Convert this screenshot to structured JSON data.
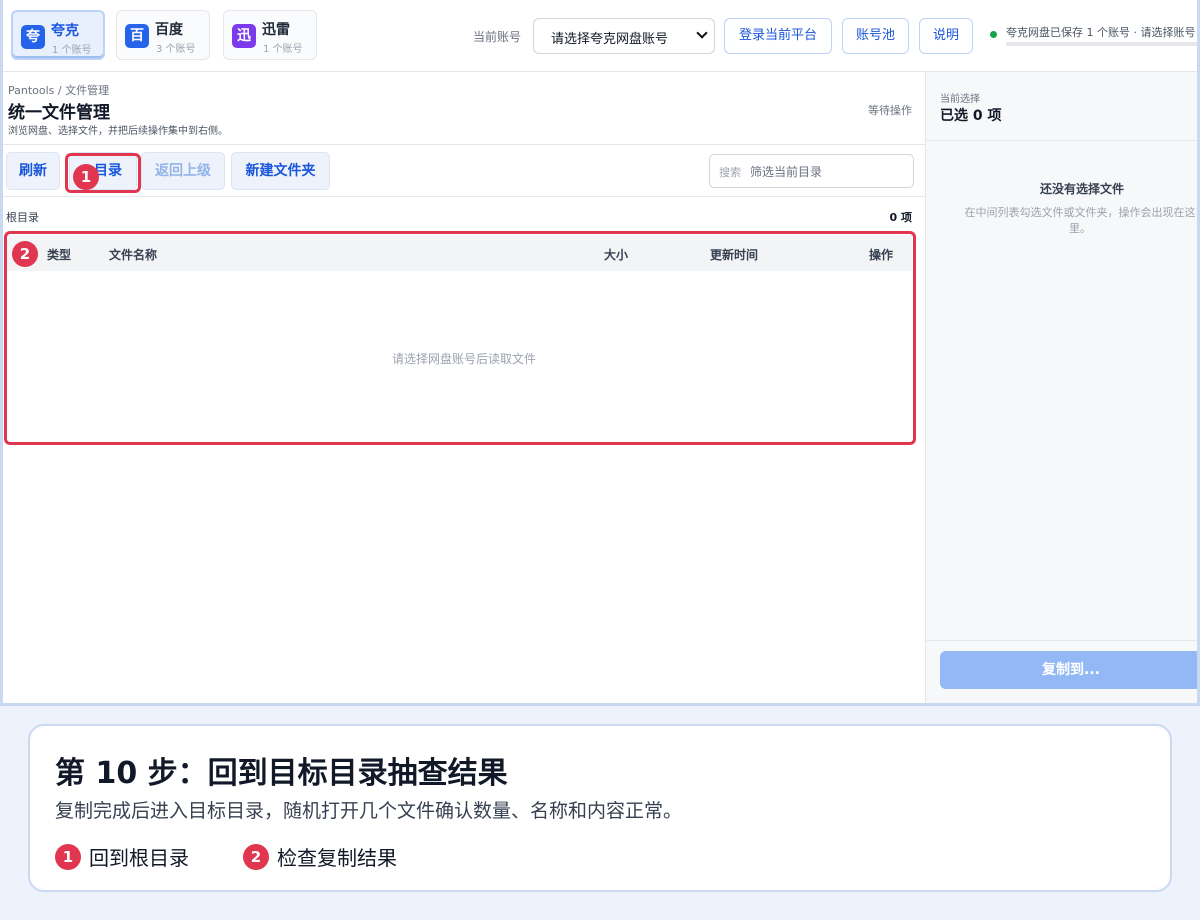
{
  "platforms": [
    {
      "name": "夸克",
      "count": "1 个账号",
      "logo": "夸",
      "color": "#2563eb"
    },
    {
      "name": "百度",
      "count": "3 个账号",
      "logo": "百",
      "color": "#2563eb"
    },
    {
      "name": "迅雷",
      "count": "1 个账号",
      "logo": "迅",
      "color": "#7c3aed"
    }
  ],
  "header": {
    "account_label": "当前账号",
    "account_select": "请选择夸克网盘账号",
    "login_btn": "登录当前平台",
    "pool_btn": "账号池",
    "help_btn": "说明",
    "status": "夸克网盘已保存 1 个账号 · 请选择账号"
  },
  "main": {
    "breadcrumb": "Pantools / 文件管理",
    "title": "统一文件管理",
    "subtitle": "浏览网盘、选择文件，并把后续操作集中到右侧。",
    "waiting": "等待操作",
    "toolbar": {
      "refresh": "刷新",
      "root": "目录",
      "up": "返回上级",
      "new_folder": "新建文件夹"
    },
    "search": {
      "label": "搜索",
      "placeholder": "筛选当前目录"
    },
    "path": "根目录",
    "count": "0 项",
    "columns": {
      "type": "类型",
      "name": "文件名称",
      "size": "大小",
      "time": "更新时间",
      "action": "操作"
    },
    "empty": "请选择网盘账号后读取文件"
  },
  "right": {
    "label": "当前选择",
    "selected": "已选 0 项",
    "empty_title": "还没有选择文件",
    "empty_desc": "在中间列表勾选文件或文件夹，操作会出现在这里。",
    "copy_btn": "复制到..."
  },
  "annotations": {
    "badge1": "1",
    "badge2": "2"
  },
  "caption": {
    "title": "第 10 步：回到目标目录抽查结果",
    "desc": "复制完成后进入目标目录，随机打开几个文件确认数量、名称和内容正常。",
    "items": [
      {
        "num": "1",
        "text": "回到根目录"
      },
      {
        "num": "2",
        "text": "检查复制结果"
      }
    ]
  },
  "colors": {
    "accent": "#1a56db",
    "highlight": "#e0364f",
    "status_ok": "#16a34a"
  }
}
